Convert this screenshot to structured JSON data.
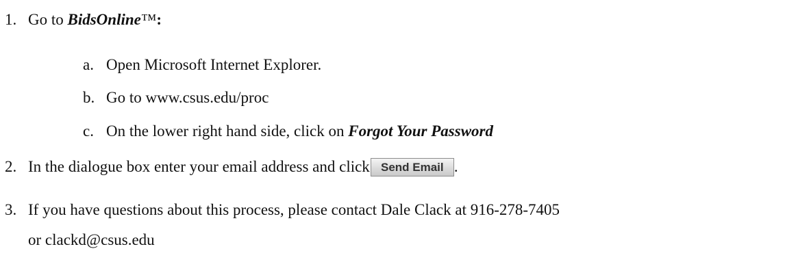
{
  "steps": [
    {
      "number": "1.",
      "prefix": "Go to ",
      "emphasis": "BidsOnline",
      "suffix": "™",
      "colon": ":",
      "substeps": [
        {
          "letter": "a.",
          "text": "Open Microsoft Internet Explorer."
        },
        {
          "letter": "b.",
          "text": "Go to www.csus.edu/proc"
        },
        {
          "letter": "c.",
          "text": "On the lower right hand side, click on ",
          "emphasis": "Forgot Your Password"
        }
      ]
    },
    {
      "number": "2.",
      "text": "In the dialogue box enter your email address and click",
      "button_label": "Send Email",
      "trailing": "."
    },
    {
      "number": "3.",
      "text": "If you have questions about this process, please contact Dale Clack at 916-278-7405",
      "continuation": "or clackd@csus.edu"
    }
  ]
}
